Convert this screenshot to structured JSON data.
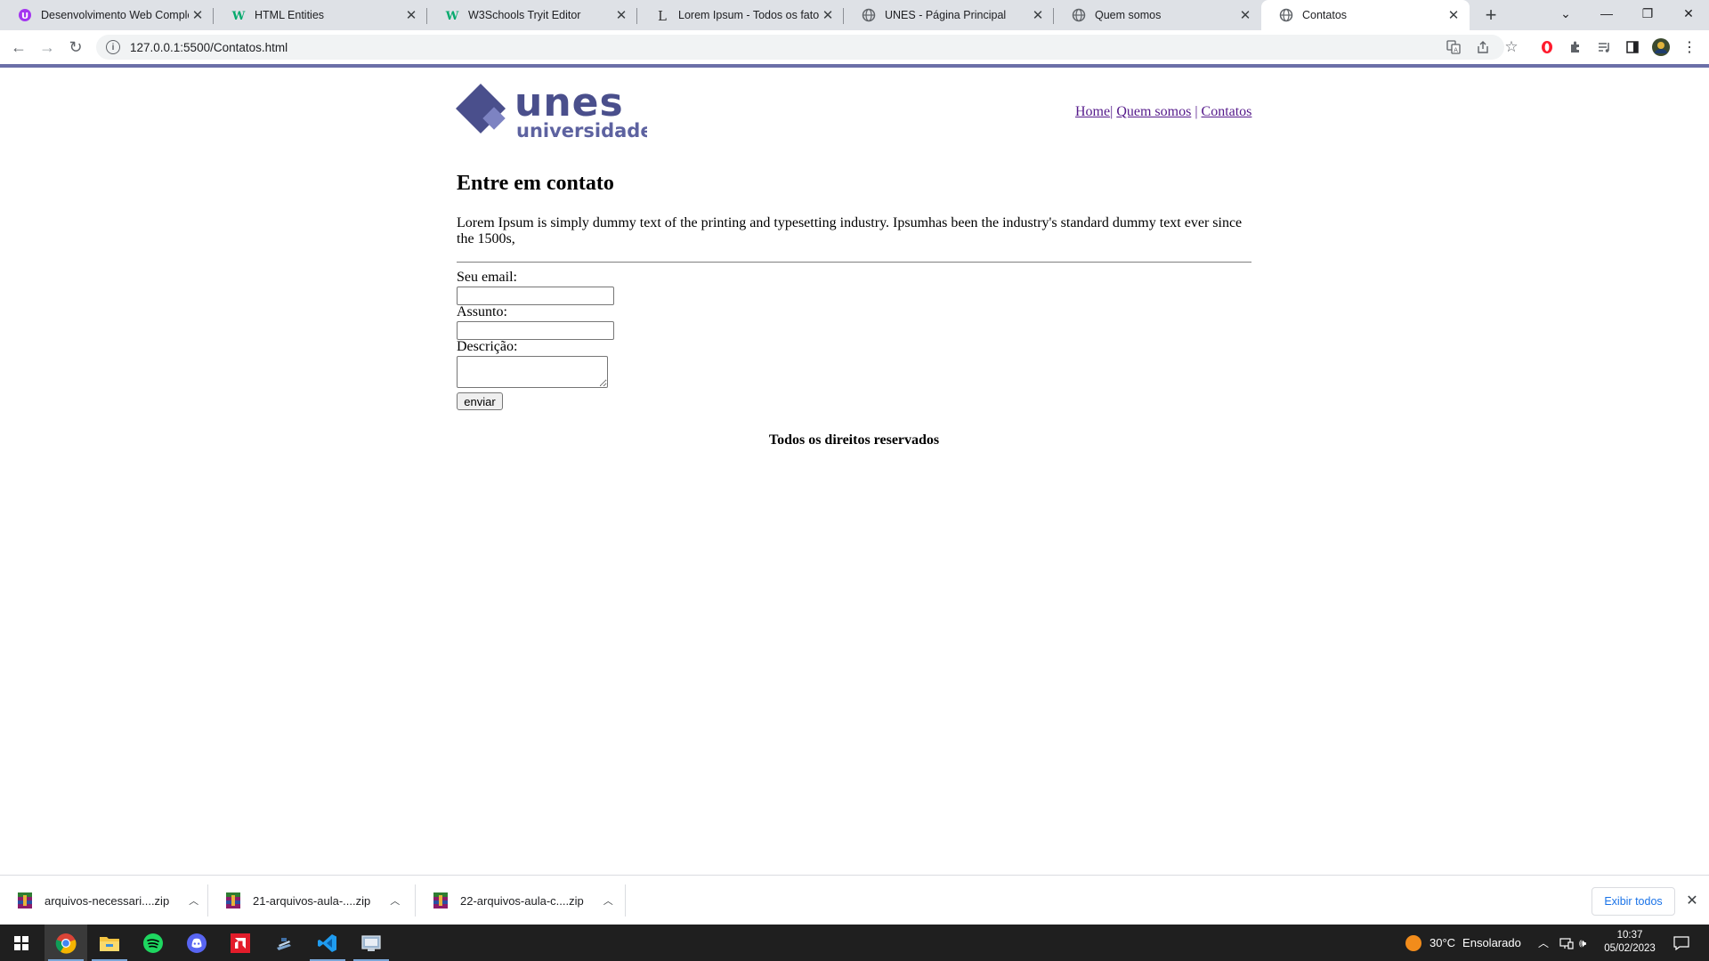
{
  "browser": {
    "tabs": [
      {
        "title": "Desenvolvimento Web Complet",
        "favicon": "udemy-icon",
        "active": false
      },
      {
        "title": "HTML Entities",
        "favicon": "w3schools-icon",
        "active": false
      },
      {
        "title": "W3Schools Tryit Editor",
        "favicon": "w3schools-icon",
        "active": false
      },
      {
        "title": "Lorem Ipsum - Todos os fatos - L",
        "favicon": "lipsum-icon",
        "active": false
      },
      {
        "title": "UNES - Página Principal",
        "favicon": "globe-icon",
        "active": false
      },
      {
        "title": "Quem somos",
        "favicon": "globe-icon",
        "active": false
      },
      {
        "title": "Contatos",
        "favicon": "globe-icon",
        "active": true
      }
    ],
    "url": "127.0.0.1:5500/Contatos.html"
  },
  "page": {
    "logo": {
      "wordmark": "unes",
      "subtitle": "universidade"
    },
    "nav": {
      "home": "Home",
      "sep1": "|",
      "about": "Quem somos",
      "sep2": "|",
      "contacts": "Contatos"
    },
    "heading": "Entre em contato",
    "paragraph": "Lorem Ipsum is simply dummy text of the printing and typesetting industry. Ipsumhas been the industry's standard dummy text ever since the 1500s,",
    "form": {
      "email_label": "Seu email:",
      "email_value": "",
      "subject_label": "Assunto:",
      "subject_value": "",
      "description_label": "Descrição:",
      "description_value": "",
      "submit_label": "enviar"
    },
    "footer": "Todos os direitos reservados"
  },
  "downloads": {
    "items": [
      {
        "name": "arquivos-necessari....zip"
      },
      {
        "name": "21-arquivos-aula-....zip"
      },
      {
        "name": "22-arquivos-aula-c....zip"
      }
    ],
    "show_all": "Exibir todos"
  },
  "taskbar": {
    "weather": {
      "temp": "30°C",
      "condition": "Ensolarado"
    },
    "time": "10:37",
    "date": "05/02/2023"
  },
  "colors": {
    "brand": "#4a4f8c",
    "link": "#551a8b",
    "tabstrip": "#dee1e6",
    "taskbar": "#1f1f1f"
  }
}
